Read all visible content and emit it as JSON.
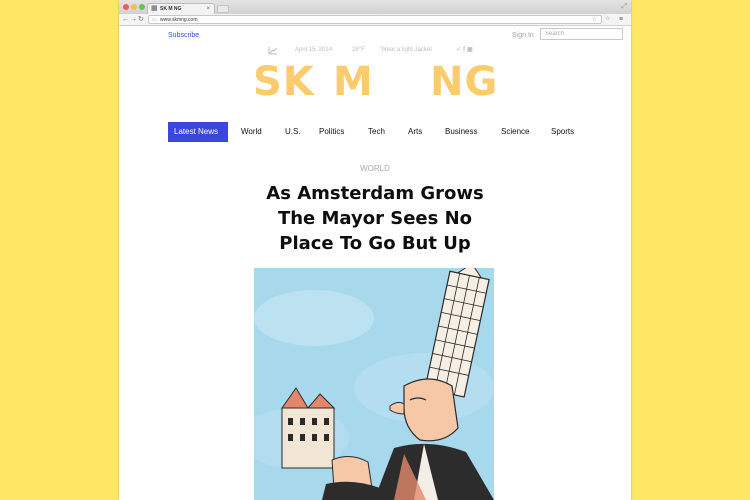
{
  "browser": {
    "tab_title": "SK M NG",
    "url": "www.skmng.com"
  },
  "page": {
    "subscribe": "Subscribe",
    "sign_in": "Sign In",
    "search_placeholder": "Search",
    "date": "April 15, 2014",
    "temperature": "28°F",
    "weather": "Wear a light Jacket",
    "logo": {
      "part1": "SK",
      "part2": "M",
      "part3": "NG"
    },
    "nav": [
      "Latest News",
      "World",
      "U.S.",
      "Politics",
      "Tech",
      "Arts",
      "Business",
      "Science",
      "Sports"
    ],
    "kicker": "WORLD",
    "headline": [
      "As Amsterdam Grows",
      "The Mayor Sees No",
      "Place To Go But Up"
    ]
  },
  "colors": {
    "background": "#FFE766",
    "accent": "#3C47DD",
    "logo": "#FCCB6B",
    "illustration_sky": "#A7D8EC"
  },
  "icons": [
    "chart-icon",
    "twitter-icon",
    "facebook-icon",
    "instagram-icon",
    "star-icon",
    "menu-icon"
  ]
}
